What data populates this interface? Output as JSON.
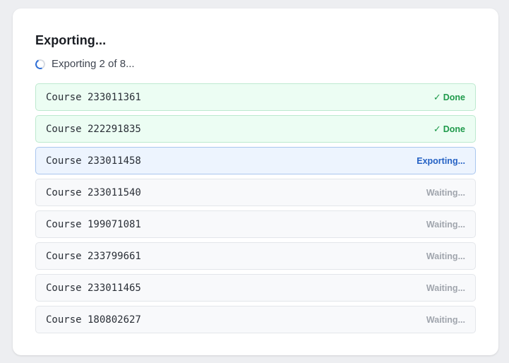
{
  "dialog": {
    "title": "Exporting...",
    "progress_text": "Exporting 2 of 8..."
  },
  "courses": [
    {
      "label": "Course 233011361",
      "status": "Done",
      "state": "done"
    },
    {
      "label": "Course 222291835",
      "status": "Done",
      "state": "done"
    },
    {
      "label": "Course 233011458",
      "status": "Exporting...",
      "state": "active"
    },
    {
      "label": "Course 233011540",
      "status": "Waiting...",
      "state": "waiting"
    },
    {
      "label": "Course 199071081",
      "status": "Waiting...",
      "state": "waiting"
    },
    {
      "label": "Course 233799661",
      "status": "Waiting...",
      "state": "waiting"
    },
    {
      "label": "Course 233011465",
      "status": "Waiting...",
      "state": "waiting"
    },
    {
      "label": "Course 180802627",
      "status": "Waiting...",
      "state": "waiting"
    }
  ],
  "icons": {
    "done": "check-icon",
    "progress": "spinner-icon"
  },
  "colors": {
    "done": "#1f9a4b",
    "active": "#2461c4",
    "waiting": "#a0a5ad"
  }
}
